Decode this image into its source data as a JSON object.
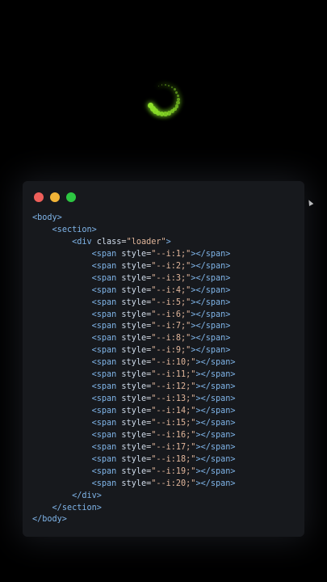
{
  "colors": {
    "background": "#000000",
    "editor_background": "#17191d",
    "loader_green": "#8ee02a",
    "tag": "#7fb4e8",
    "attribute": "#d0dceb",
    "string": "#e0b59a"
  },
  "window_controls": [
    {
      "name": "close",
      "color": "#ee5f5a"
    },
    {
      "name": "minimize",
      "color": "#f2b437"
    },
    {
      "name": "zoom",
      "color": "#2dc742"
    }
  ],
  "loader": {
    "dot_count": 20
  },
  "code": {
    "lines": [
      {
        "indent": "",
        "tokens": [
          {
            "t": "tag",
            "v": "<body>"
          }
        ]
      },
      {
        "indent": "    ",
        "tokens": [
          {
            "t": "tag",
            "v": "<section>"
          }
        ]
      },
      {
        "indent": "        ",
        "tokens": [
          {
            "t": "tag",
            "v": "<div "
          },
          {
            "t": "attr",
            "v": "class"
          },
          {
            "t": "eq",
            "v": "="
          },
          {
            "t": "str",
            "v": "\"loader\""
          },
          {
            "t": "tag",
            "v": ">"
          }
        ]
      },
      {
        "indent": "            ",
        "tokens": [
          {
            "t": "tag",
            "v": "<span "
          },
          {
            "t": "attr",
            "v": "style"
          },
          {
            "t": "eq",
            "v": "="
          },
          {
            "t": "str",
            "v": "\"--i:1;\""
          },
          {
            "t": "tag",
            "v": "></span>"
          }
        ]
      },
      {
        "indent": "            ",
        "tokens": [
          {
            "t": "tag",
            "v": "<span "
          },
          {
            "t": "attr",
            "v": "style"
          },
          {
            "t": "eq",
            "v": "="
          },
          {
            "t": "str",
            "v": "\"--i:2;\""
          },
          {
            "t": "tag",
            "v": "></span>"
          }
        ]
      },
      {
        "indent": "            ",
        "tokens": [
          {
            "t": "tag",
            "v": "<span "
          },
          {
            "t": "attr",
            "v": "style"
          },
          {
            "t": "eq",
            "v": "="
          },
          {
            "t": "str",
            "v": "\"--i:3;\""
          },
          {
            "t": "tag",
            "v": "></span>"
          }
        ]
      },
      {
        "indent": "            ",
        "tokens": [
          {
            "t": "tag",
            "v": "<span "
          },
          {
            "t": "attr",
            "v": "style"
          },
          {
            "t": "eq",
            "v": "="
          },
          {
            "t": "str",
            "v": "\"--i:4;\""
          },
          {
            "t": "tag",
            "v": "></span>"
          }
        ]
      },
      {
        "indent": "            ",
        "tokens": [
          {
            "t": "tag",
            "v": "<span "
          },
          {
            "t": "attr",
            "v": "style"
          },
          {
            "t": "eq",
            "v": "="
          },
          {
            "t": "str",
            "v": "\"--i:5;\""
          },
          {
            "t": "tag",
            "v": "></span>"
          }
        ]
      },
      {
        "indent": "            ",
        "tokens": [
          {
            "t": "tag",
            "v": "<span "
          },
          {
            "t": "attr",
            "v": "style"
          },
          {
            "t": "eq",
            "v": "="
          },
          {
            "t": "str",
            "v": "\"--i:6;\""
          },
          {
            "t": "tag",
            "v": "></span>"
          }
        ]
      },
      {
        "indent": "            ",
        "tokens": [
          {
            "t": "tag",
            "v": "<span "
          },
          {
            "t": "attr",
            "v": "style"
          },
          {
            "t": "eq",
            "v": "="
          },
          {
            "t": "str",
            "v": "\"--i:7;\""
          },
          {
            "t": "tag",
            "v": "></span>"
          }
        ]
      },
      {
        "indent": "            ",
        "tokens": [
          {
            "t": "tag",
            "v": "<span "
          },
          {
            "t": "attr",
            "v": "style"
          },
          {
            "t": "eq",
            "v": "="
          },
          {
            "t": "str",
            "v": "\"--i:8;\""
          },
          {
            "t": "tag",
            "v": "></span>"
          }
        ]
      },
      {
        "indent": "            ",
        "tokens": [
          {
            "t": "tag",
            "v": "<span "
          },
          {
            "t": "attr",
            "v": "style"
          },
          {
            "t": "eq",
            "v": "="
          },
          {
            "t": "str",
            "v": "\"--i:9;\""
          },
          {
            "t": "tag",
            "v": "></span>"
          }
        ]
      },
      {
        "indent": "            ",
        "tokens": [
          {
            "t": "tag",
            "v": "<span "
          },
          {
            "t": "attr",
            "v": "style"
          },
          {
            "t": "eq",
            "v": "="
          },
          {
            "t": "str",
            "v": "\"--i:10;\""
          },
          {
            "t": "tag",
            "v": "></span>"
          }
        ]
      },
      {
        "indent": "            ",
        "tokens": [
          {
            "t": "tag",
            "v": "<span "
          },
          {
            "t": "attr",
            "v": "style"
          },
          {
            "t": "eq",
            "v": "="
          },
          {
            "t": "str",
            "v": "\"--i:11;\""
          },
          {
            "t": "tag",
            "v": "></span>"
          }
        ]
      },
      {
        "indent": "            ",
        "tokens": [
          {
            "t": "tag",
            "v": "<span "
          },
          {
            "t": "attr",
            "v": "style"
          },
          {
            "t": "eq",
            "v": "="
          },
          {
            "t": "str",
            "v": "\"--i:12;\""
          },
          {
            "t": "tag",
            "v": "></span>"
          }
        ]
      },
      {
        "indent": "            ",
        "tokens": [
          {
            "t": "tag",
            "v": "<span "
          },
          {
            "t": "attr",
            "v": "style"
          },
          {
            "t": "eq",
            "v": "="
          },
          {
            "t": "str",
            "v": "\"--i:13;\""
          },
          {
            "t": "tag",
            "v": "></span>"
          }
        ]
      },
      {
        "indent": "            ",
        "tokens": [
          {
            "t": "tag",
            "v": "<span "
          },
          {
            "t": "attr",
            "v": "style"
          },
          {
            "t": "eq",
            "v": "="
          },
          {
            "t": "str",
            "v": "\"--i:14;\""
          },
          {
            "t": "tag",
            "v": "></span>"
          }
        ]
      },
      {
        "indent": "            ",
        "tokens": [
          {
            "t": "tag",
            "v": "<span "
          },
          {
            "t": "attr",
            "v": "style"
          },
          {
            "t": "eq",
            "v": "="
          },
          {
            "t": "str",
            "v": "\"--i:15;\""
          },
          {
            "t": "tag",
            "v": "></span>"
          }
        ]
      },
      {
        "indent": "            ",
        "tokens": [
          {
            "t": "tag",
            "v": "<span "
          },
          {
            "t": "attr",
            "v": "style"
          },
          {
            "t": "eq",
            "v": "="
          },
          {
            "t": "str",
            "v": "\"--i:16;\""
          },
          {
            "t": "tag",
            "v": "></span>"
          }
        ]
      },
      {
        "indent": "            ",
        "tokens": [
          {
            "t": "tag",
            "v": "<span "
          },
          {
            "t": "attr",
            "v": "style"
          },
          {
            "t": "eq",
            "v": "="
          },
          {
            "t": "str",
            "v": "\"--i:17;\""
          },
          {
            "t": "tag",
            "v": "></span>"
          }
        ]
      },
      {
        "indent": "            ",
        "tokens": [
          {
            "t": "tag",
            "v": "<span "
          },
          {
            "t": "attr",
            "v": "style"
          },
          {
            "t": "eq",
            "v": "="
          },
          {
            "t": "str",
            "v": "\"--i:18;\""
          },
          {
            "t": "tag",
            "v": "></span>"
          }
        ]
      },
      {
        "indent": "            ",
        "tokens": [
          {
            "t": "tag",
            "v": "<span "
          },
          {
            "t": "attr",
            "v": "style"
          },
          {
            "t": "eq",
            "v": "="
          },
          {
            "t": "str",
            "v": "\"--i:19;\""
          },
          {
            "t": "tag",
            "v": "></span>"
          }
        ]
      },
      {
        "indent": "            ",
        "tokens": [
          {
            "t": "tag",
            "v": "<span "
          },
          {
            "t": "attr",
            "v": "style"
          },
          {
            "t": "eq",
            "v": "="
          },
          {
            "t": "str",
            "v": "\"--i:20;\""
          },
          {
            "t": "tag",
            "v": "></span>"
          }
        ]
      },
      {
        "indent": "        ",
        "tokens": [
          {
            "t": "tag",
            "v": "</div>"
          }
        ]
      },
      {
        "indent": "    ",
        "tokens": [
          {
            "t": "tag",
            "v": "</section>"
          }
        ]
      },
      {
        "indent": "",
        "tokens": [
          {
            "t": "tag",
            "v": "</body>"
          }
        ]
      }
    ]
  }
}
